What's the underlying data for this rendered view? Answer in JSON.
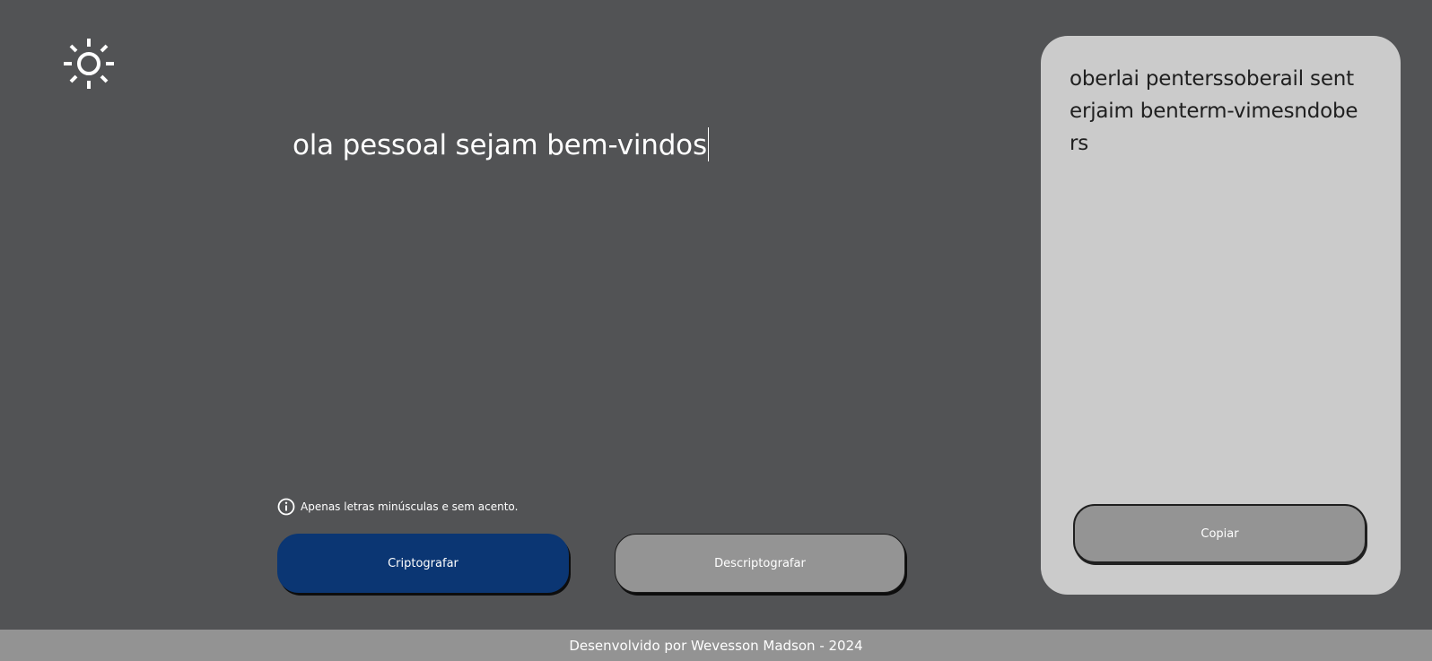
{
  "theme_toggle": {
    "icon": "sun-icon"
  },
  "input": {
    "value": "ola pessoal sejam bem-vindos",
    "placeholder": ""
  },
  "hint": {
    "icon": "info-icon",
    "text": "Apenas letras minúsculas e sem acento."
  },
  "actions": {
    "encrypt_label": "Criptografar",
    "decrypt_label": "Descriptografar"
  },
  "output": {
    "text": "oberlai penterssoberail senterjaim benterm-vimesndobers",
    "copy_label": "Copiar"
  },
  "footer": {
    "text": "Desenvolvido por Wevesson Madson - 2024"
  },
  "colors": {
    "background": "#525355",
    "primary_button": "#0b3673",
    "secondary_button": "#949494",
    "panel": "#cbcbcb",
    "footer": "#939393"
  }
}
